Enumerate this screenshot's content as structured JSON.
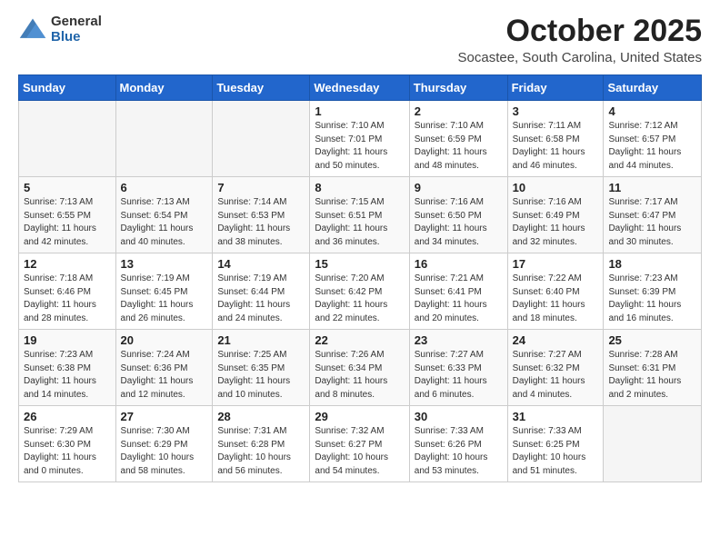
{
  "logo": {
    "general": "General",
    "blue": "Blue"
  },
  "title": {
    "month": "October 2025",
    "location": "Socastee, South Carolina, United States"
  },
  "weekdays": [
    "Sunday",
    "Monday",
    "Tuesday",
    "Wednesday",
    "Thursday",
    "Friday",
    "Saturday"
  ],
  "weeks": [
    [
      {
        "day": "",
        "info": ""
      },
      {
        "day": "",
        "info": ""
      },
      {
        "day": "",
        "info": ""
      },
      {
        "day": "1",
        "info": "Sunrise: 7:10 AM\nSunset: 7:01 PM\nDaylight: 11 hours\nand 50 minutes."
      },
      {
        "day": "2",
        "info": "Sunrise: 7:10 AM\nSunset: 6:59 PM\nDaylight: 11 hours\nand 48 minutes."
      },
      {
        "day": "3",
        "info": "Sunrise: 7:11 AM\nSunset: 6:58 PM\nDaylight: 11 hours\nand 46 minutes."
      },
      {
        "day": "4",
        "info": "Sunrise: 7:12 AM\nSunset: 6:57 PM\nDaylight: 11 hours\nand 44 minutes."
      }
    ],
    [
      {
        "day": "5",
        "info": "Sunrise: 7:13 AM\nSunset: 6:55 PM\nDaylight: 11 hours\nand 42 minutes."
      },
      {
        "day": "6",
        "info": "Sunrise: 7:13 AM\nSunset: 6:54 PM\nDaylight: 11 hours\nand 40 minutes."
      },
      {
        "day": "7",
        "info": "Sunrise: 7:14 AM\nSunset: 6:53 PM\nDaylight: 11 hours\nand 38 minutes."
      },
      {
        "day": "8",
        "info": "Sunrise: 7:15 AM\nSunset: 6:51 PM\nDaylight: 11 hours\nand 36 minutes."
      },
      {
        "day": "9",
        "info": "Sunrise: 7:16 AM\nSunset: 6:50 PM\nDaylight: 11 hours\nand 34 minutes."
      },
      {
        "day": "10",
        "info": "Sunrise: 7:16 AM\nSunset: 6:49 PM\nDaylight: 11 hours\nand 32 minutes."
      },
      {
        "day": "11",
        "info": "Sunrise: 7:17 AM\nSunset: 6:47 PM\nDaylight: 11 hours\nand 30 minutes."
      }
    ],
    [
      {
        "day": "12",
        "info": "Sunrise: 7:18 AM\nSunset: 6:46 PM\nDaylight: 11 hours\nand 28 minutes."
      },
      {
        "day": "13",
        "info": "Sunrise: 7:19 AM\nSunset: 6:45 PM\nDaylight: 11 hours\nand 26 minutes."
      },
      {
        "day": "14",
        "info": "Sunrise: 7:19 AM\nSunset: 6:44 PM\nDaylight: 11 hours\nand 24 minutes."
      },
      {
        "day": "15",
        "info": "Sunrise: 7:20 AM\nSunset: 6:42 PM\nDaylight: 11 hours\nand 22 minutes."
      },
      {
        "day": "16",
        "info": "Sunrise: 7:21 AM\nSunset: 6:41 PM\nDaylight: 11 hours\nand 20 minutes."
      },
      {
        "day": "17",
        "info": "Sunrise: 7:22 AM\nSunset: 6:40 PM\nDaylight: 11 hours\nand 18 minutes."
      },
      {
        "day": "18",
        "info": "Sunrise: 7:23 AM\nSunset: 6:39 PM\nDaylight: 11 hours\nand 16 minutes."
      }
    ],
    [
      {
        "day": "19",
        "info": "Sunrise: 7:23 AM\nSunset: 6:38 PM\nDaylight: 11 hours\nand 14 minutes."
      },
      {
        "day": "20",
        "info": "Sunrise: 7:24 AM\nSunset: 6:36 PM\nDaylight: 11 hours\nand 12 minutes."
      },
      {
        "day": "21",
        "info": "Sunrise: 7:25 AM\nSunset: 6:35 PM\nDaylight: 11 hours\nand 10 minutes."
      },
      {
        "day": "22",
        "info": "Sunrise: 7:26 AM\nSunset: 6:34 PM\nDaylight: 11 hours\nand 8 minutes."
      },
      {
        "day": "23",
        "info": "Sunrise: 7:27 AM\nSunset: 6:33 PM\nDaylight: 11 hours\nand 6 minutes."
      },
      {
        "day": "24",
        "info": "Sunrise: 7:27 AM\nSunset: 6:32 PM\nDaylight: 11 hours\nand 4 minutes."
      },
      {
        "day": "25",
        "info": "Sunrise: 7:28 AM\nSunset: 6:31 PM\nDaylight: 11 hours\nand 2 minutes."
      }
    ],
    [
      {
        "day": "26",
        "info": "Sunrise: 7:29 AM\nSunset: 6:30 PM\nDaylight: 11 hours\nand 0 minutes."
      },
      {
        "day": "27",
        "info": "Sunrise: 7:30 AM\nSunset: 6:29 PM\nDaylight: 10 hours\nand 58 minutes."
      },
      {
        "day": "28",
        "info": "Sunrise: 7:31 AM\nSunset: 6:28 PM\nDaylight: 10 hours\nand 56 minutes."
      },
      {
        "day": "29",
        "info": "Sunrise: 7:32 AM\nSunset: 6:27 PM\nDaylight: 10 hours\nand 54 minutes."
      },
      {
        "day": "30",
        "info": "Sunrise: 7:33 AM\nSunset: 6:26 PM\nDaylight: 10 hours\nand 53 minutes."
      },
      {
        "day": "31",
        "info": "Sunrise: 7:33 AM\nSunset: 6:25 PM\nDaylight: 10 hours\nand 51 minutes."
      },
      {
        "day": "",
        "info": ""
      }
    ]
  ]
}
